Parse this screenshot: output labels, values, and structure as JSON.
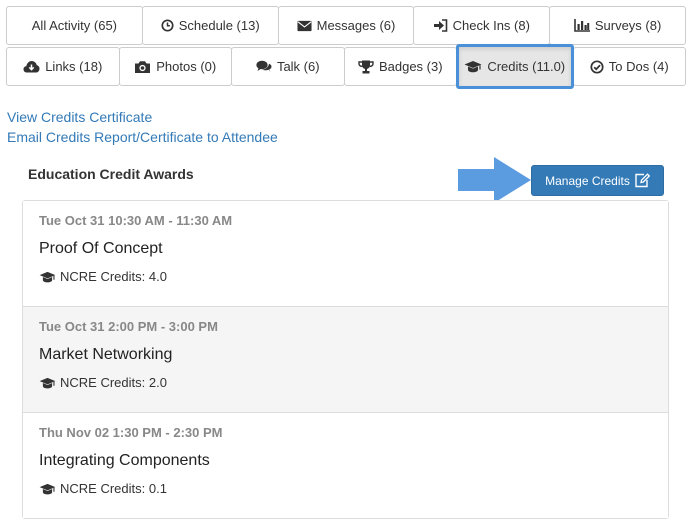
{
  "tabs": {
    "row1": [
      {
        "label": "All Activity (65)",
        "icon": ""
      },
      {
        "label": "Schedule (13)",
        "icon": "clock-icon"
      },
      {
        "label": "Messages (6)",
        "icon": "envelope-icon"
      },
      {
        "label": "Check Ins (8)",
        "icon": "sign-in-icon"
      },
      {
        "label": "Surveys (8)",
        "icon": "bar-chart-icon"
      }
    ],
    "row2": [
      {
        "label": "Links (18)",
        "icon": "cloud-download-icon"
      },
      {
        "label": "Photos (0)",
        "icon": "camera-icon"
      },
      {
        "label": "Talk (6)",
        "icon": "comments-icon"
      },
      {
        "label": "Badges (3)",
        "icon": "trophy-icon"
      },
      {
        "label": "Credits (11.0)",
        "icon": "graduation-cap-icon",
        "active": true
      },
      {
        "label": "To Dos (4)",
        "icon": "check-circle-icon"
      }
    ]
  },
  "links": {
    "view_certificate": "View Credits Certificate",
    "email_report": "Email Credits Report/Certificate to Attendee"
  },
  "section": {
    "title": "Education Credit Awards",
    "manage_label": "Manage Credits",
    "manage_icon": "edit-icon"
  },
  "awards": [
    {
      "time": "Tue Oct 31 10:30 AM - 11:30 AM",
      "name": "Proof Of Concept",
      "credit": "NCRE Credits: 4.0"
    },
    {
      "time": "Tue Oct 31 2:00 PM - 3:00 PM",
      "name": "Market Networking",
      "credit": "NCRE Credits: 2.0"
    },
    {
      "time": "Thu Nov 02 1:30 PM - 2:30 PM",
      "name": "Integrating Components",
      "credit": "NCRE Credits: 0.1"
    }
  ],
  "colors": {
    "accent": "#337ab7",
    "active_tab_border": "#4a90d9",
    "arrow": "#5b9be0",
    "muted_text": "#888888"
  }
}
